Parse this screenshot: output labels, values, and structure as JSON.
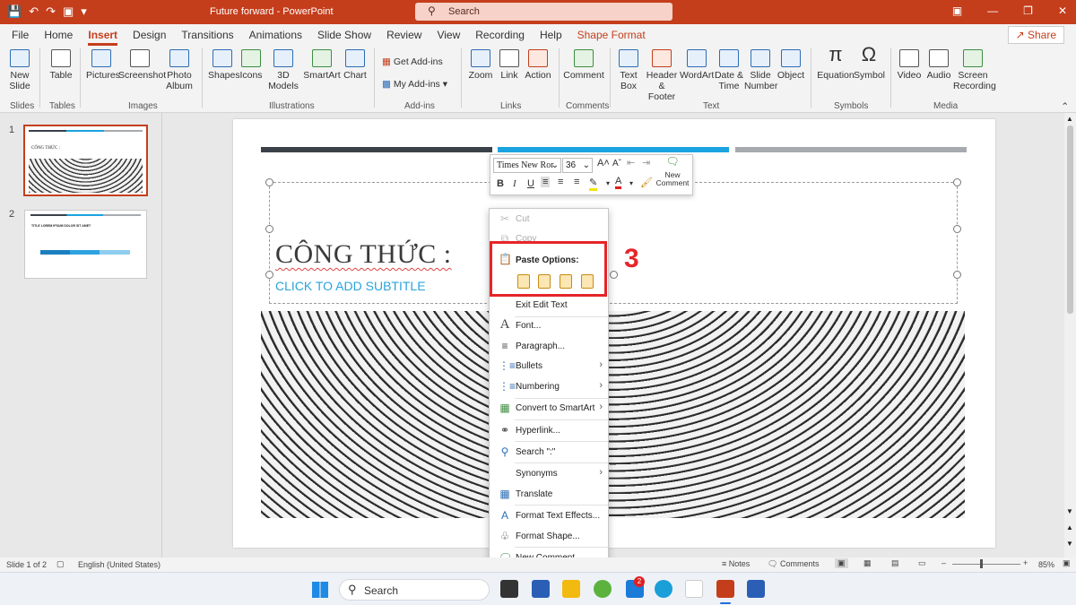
{
  "window": {
    "title": "Future forward  -  PowerPoint",
    "search_placeholder": "Search"
  },
  "menu": {
    "tabs": [
      "File",
      "Home",
      "Insert",
      "Design",
      "Transitions",
      "Animations",
      "Slide Show",
      "Review",
      "View",
      "Recording",
      "Help",
      "Shape Format"
    ],
    "active": "Insert",
    "share": "Share"
  },
  "ribbon": {
    "new_slide": "New\nSlide",
    "table": "Table",
    "pictures": "Pictures",
    "screenshot": "Screenshot",
    "photo_album": "Photo\nAlbum",
    "shapes": "Shapes",
    "icons": "Icons",
    "models_3d": "3D\nModels",
    "smartart": "SmartArt",
    "chart": "Chart",
    "get_addins": "Get Add-ins",
    "my_addins": "My Add-ins",
    "zoom": "Zoom",
    "link": "Link",
    "action": "Action",
    "comment": "Comment",
    "text_box": "Text\nBox",
    "header_footer": "Header\n& Footer",
    "wordart": "WordArt",
    "date_time": "Date &\nTime",
    "slide_number": "Slide\nNumber",
    "object": "Object",
    "equation": "Equation",
    "symbol": "Symbol",
    "video": "Video",
    "audio": "Audio",
    "screen_recording": "Screen\nRecording",
    "groups": {
      "slides": "Slides",
      "tables": "Tables",
      "images": "Images",
      "illustrations": "Illustrations",
      "addins": "Add-ins",
      "links": "Links",
      "comments": "Comments",
      "text": "Text",
      "symbols": "Symbols",
      "media": "Media"
    }
  },
  "thumbnails": {
    "slide1_num": "1",
    "slide1_title": "CÔNG THỨC :",
    "slide2_num": "2",
    "slide2_title": "TITLE LOREM IPSUM DOLOR SIT AMET"
  },
  "slide": {
    "title": "CÔNG THỨC :",
    "subtitle": "CLICK TO ADD SUBTITLE",
    "bar_colors": [
      "#3a4148",
      "#1aa3e0",
      "#a7abaf"
    ]
  },
  "mini_toolbar": {
    "font": "Times New Ror",
    "size": "36",
    "new_comment": "New\nComment"
  },
  "context_menu": {
    "cut": "Cut",
    "copy": "Copy",
    "paste_options": "Paste Options:",
    "exit_edit": "Exit Edit Text",
    "font": "Font...",
    "paragraph": "Paragraph...",
    "bullets": "Bullets",
    "numbering": "Numbering",
    "convert_smartart": "Convert to SmartArt",
    "hyperlink": "Hyperlink...",
    "search": "Search \":\"",
    "synonyms": "Synonyms",
    "translate": "Translate",
    "format_text_effects": "Format Text Effects...",
    "format_shape": "Format Shape...",
    "new_comment": "New Comment"
  },
  "annotation": "3",
  "status": {
    "slide_info": "Slide 1 of 2",
    "language": "English (United States)",
    "notes": "Notes",
    "comments": "Comments",
    "zoom": "85%"
  },
  "taskbar": {
    "search": "Search",
    "badge": "2"
  }
}
